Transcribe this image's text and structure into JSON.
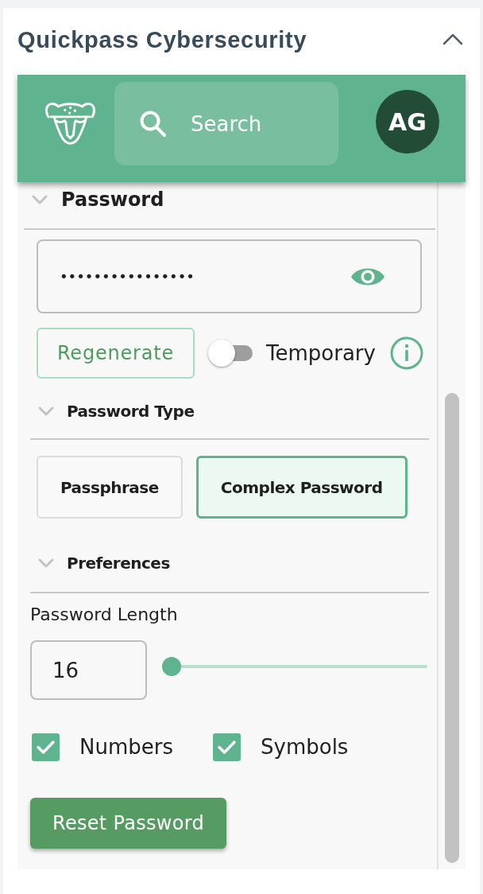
{
  "card": {
    "title": "Quickpass Cybersecurity",
    "expanded": true
  },
  "header": {
    "search": {
      "placeholder": "Search"
    },
    "avatar": "AG"
  },
  "password": {
    "title": "Password",
    "expanded": true,
    "value": "••••••••••••••••",
    "regenerate_button": "Regenerate",
    "temporary": {
      "label": "Temporary",
      "on": false
    },
    "type_section": {
      "title": "Password Type",
      "expanded": true,
      "options": [
        {
          "label": "Passphrase",
          "selected": false
        },
        {
          "label": "Complex Password",
          "selected": true
        }
      ]
    },
    "preferences": {
      "title": "Preferences",
      "expanded": true,
      "length_label": "Password Length",
      "length_value": "16",
      "slider": {
        "level": 0
      },
      "options": [
        {
          "label": "Numbers",
          "checked": true
        },
        {
          "label": "Symbols",
          "checked": true
        }
      ],
      "reset_button": "Reset Password"
    }
  }
}
